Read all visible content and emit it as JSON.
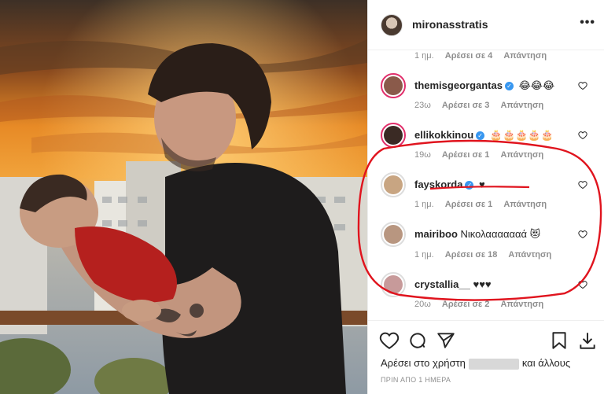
{
  "post": {
    "username": "mironasstratis",
    "more_icon": "ellipsis-icon",
    "top_meta": {
      "time": "1 ημ.",
      "likes": "Αρέσει σε 4",
      "reply": "Απάντηση"
    }
  },
  "comments": [
    {
      "username": "themisgeorgantas",
      "verified": true,
      "text": "😂😂😂",
      "time": "23ω",
      "likes": "Αρέσει σε 3",
      "reply": "Απάντηση",
      "avatar_color": "#8a5a4a"
    },
    {
      "username": "ellikokkinou",
      "verified": true,
      "text": "🎂🎂🎂🎂🎂",
      "time": "19ω",
      "likes": "Αρέσει σε 1",
      "reply": "Απάντηση",
      "avatar_color": "#3a2a24"
    },
    {
      "username": "fayskorda",
      "verified": true,
      "text": "♥",
      "time": "1 ημ.",
      "likes": "Αρέσει σε 1",
      "reply": "Απάντηση",
      "avatar_color": "#c8a582"
    },
    {
      "username": "mairiboo",
      "verified": false,
      "text": "Νικολααααααά 😻",
      "time": "1 ημ.",
      "likes": "Αρέσει σε 18",
      "reply": "Απάντηση",
      "avatar_color": "#b89680"
    },
    {
      "username": "crystallia__",
      "verified": false,
      "text": "♥♥♥",
      "time": "20ω",
      "likes": "Αρέσει σε 2",
      "reply": "Απάντηση",
      "avatar_color": "#c79a9a"
    }
  ],
  "actions": {
    "like_icon": "heart-icon",
    "comment_icon": "comment-icon",
    "share_icon": "send-icon",
    "save_icon": "bookmark-icon",
    "download_icon": "download-icon"
  },
  "likes_line": {
    "prefix": "Αρέσει στο χρήστη",
    "suffix": "και άλλους"
  },
  "post_time": "ΠΡΙΝ ΑΠΟ 1 ΗΜΕΡΑ",
  "colors": {
    "annotation": "#e0141e",
    "verified": "#3897f0",
    "story_ring": "#e1306c",
    "meta": "#8e8e8e"
  }
}
